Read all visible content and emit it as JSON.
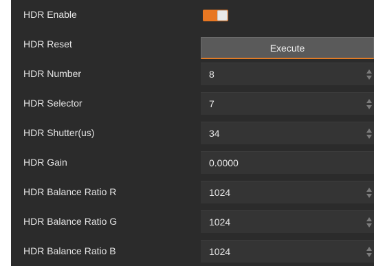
{
  "settings": {
    "rows": [
      {
        "label": "HDR Enable",
        "type": "toggle",
        "on": true
      },
      {
        "label": "HDR Reset",
        "type": "button",
        "button_label": "Execute"
      },
      {
        "label": "HDR Number",
        "type": "spin",
        "value": "8"
      },
      {
        "label": "HDR Selector",
        "type": "spin",
        "value": "7"
      },
      {
        "label": "HDR Shutter(us)",
        "type": "spin",
        "value": "34"
      },
      {
        "label": "HDR Gain",
        "type": "text",
        "value": "0.0000"
      },
      {
        "label": "HDR Balance Ratio R",
        "type": "spin",
        "value": "1024"
      },
      {
        "label": "HDR Balance Ratio G",
        "type": "spin",
        "value": "1024"
      },
      {
        "label": "HDR Balance Ratio B",
        "type": "spin",
        "value": "1024"
      }
    ]
  },
  "colors": {
    "panel_bg": "#2b2b2b",
    "field_bg": "#343434",
    "accent": "#e87722",
    "button_bg": "#5a5a5a"
  },
  "icons": {
    "spin_up": "triangle-up",
    "spin_down": "triangle-down"
  }
}
